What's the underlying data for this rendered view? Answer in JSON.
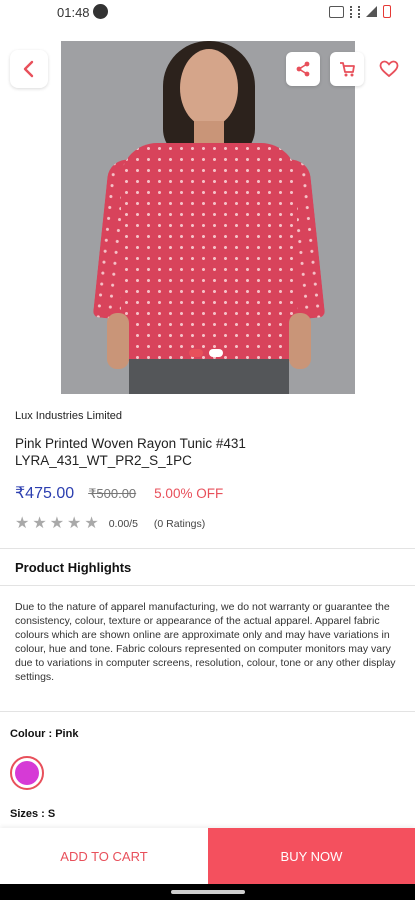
{
  "status_bar": {
    "time": "01:48"
  },
  "product": {
    "brand": "Lux Industries Limited",
    "name": "Pink Printed Woven Rayon Tunic #431 LYRA_431_WT_PR2_S_1PC",
    "price": "₹475.00",
    "mrp": "₹500.00",
    "discount": "5.00% OFF",
    "rating_value": "0.00/5",
    "rating_count": "(0 Ratings)",
    "stars_filled": 0,
    "stars_total": 5,
    "image_carousel": {
      "total": 2,
      "active_index": 0
    }
  },
  "highlights": {
    "title": "Product Highlights",
    "text": "Due to the nature of apparel manufacturing, we do not warranty or guarantee the consistency, colour, texture or appearance of the actual apparel. Apparel fabric colours which are shown online are approximate only and may have variations in colour, hue and tone. Fabric colours represented on computer monitors may vary due to variations in computer screens, resolution, colour, tone or any other display settings."
  },
  "options": {
    "colour_label": "Colour :  Pink",
    "colour_swatch": "#d63ad6",
    "sizes_label": "Sizes :  S"
  },
  "actions": {
    "add_to_cart": "ADD TO CART",
    "buy_now": "BUY NOW"
  },
  "colors": {
    "accent": "#f4505e",
    "price": "#2c3fb0",
    "star_empty": "#a9a9a9"
  }
}
